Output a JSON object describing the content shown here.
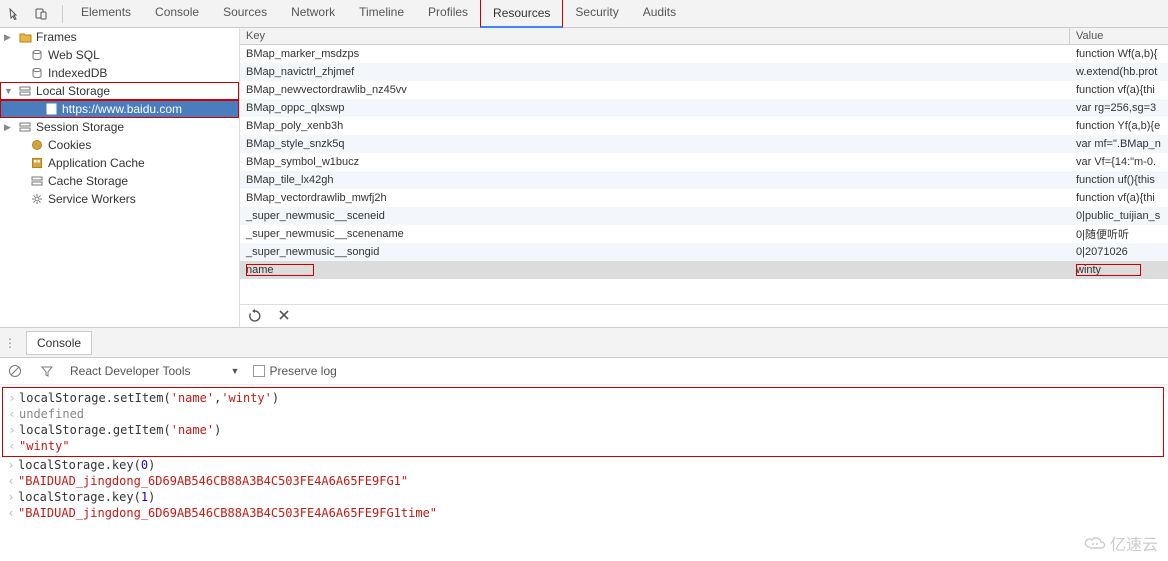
{
  "tabs": {
    "items": [
      "Elements",
      "Console",
      "Sources",
      "Network",
      "Timeline",
      "Profiles",
      "Resources",
      "Security",
      "Audits"
    ],
    "active_index": 6
  },
  "sidebar": {
    "items": [
      {
        "label": "Frames",
        "icon": "folder",
        "expandable": true,
        "expanded": false,
        "indent": 0
      },
      {
        "label": "Web SQL",
        "icon": "db",
        "expandable": false,
        "indent": 1
      },
      {
        "label": "IndexedDB",
        "icon": "db",
        "expandable": false,
        "indent": 1
      },
      {
        "label": "Local Storage",
        "icon": "storage",
        "expandable": true,
        "expanded": true,
        "indent": 0,
        "highlight": true
      },
      {
        "label": "https://www.baidu.com",
        "icon": "page",
        "expandable": false,
        "indent": 2,
        "selected": true,
        "highlight": true
      },
      {
        "label": "Session Storage",
        "icon": "storage",
        "expandable": true,
        "expanded": false,
        "indent": 0
      },
      {
        "label": "Cookies",
        "icon": "cookie",
        "expandable": false,
        "indent": 1
      },
      {
        "label": "Application Cache",
        "icon": "appcache",
        "expandable": false,
        "indent": 1
      },
      {
        "label": "Cache Storage",
        "icon": "cache",
        "expandable": false,
        "indent": 1
      },
      {
        "label": "Service Workers",
        "icon": "gear",
        "expandable": false,
        "indent": 1
      }
    ]
  },
  "table": {
    "headers": {
      "key": "Key",
      "value": "Value"
    },
    "rows": [
      {
        "key": "BMap_marker_msdzps",
        "value": "function Wf(a,b){"
      },
      {
        "key": "BMap_navictrl_zhjmef",
        "value": "w.extend(hb.prot"
      },
      {
        "key": "BMap_newvectordrawlib_nz45vv",
        "value": "function vf(a){thi"
      },
      {
        "key": "BMap_oppc_qlxswp",
        "value": "var rg=256,sg=3"
      },
      {
        "key": "BMap_poly_xenb3h",
        "value": "function Yf(a,b){e"
      },
      {
        "key": "BMap_style_snzk5q",
        "value": "var mf=\".BMap_n"
      },
      {
        "key": "BMap_symbol_w1bucz",
        "value": "var Vf={14:\"m-0."
      },
      {
        "key": "BMap_tile_lx42gh",
        "value": "function uf(){this"
      },
      {
        "key": "BMap_vectordrawlib_mwfj2h",
        "value": "function vf(a){thi"
      },
      {
        "key": "_super_newmusic__sceneid",
        "value": "0|public_tuijian_s"
      },
      {
        "key": "_super_newmusic__scenename",
        "value": "0|随便听听"
      },
      {
        "key": "_super_newmusic__songid",
        "value": "0|2071026"
      },
      {
        "key": "name",
        "value": "winty",
        "selected": true,
        "key_hl": true,
        "val_hl": true
      }
    ]
  },
  "toolbar": {
    "refresh": "↻",
    "delete": "✕"
  },
  "drawer": {
    "tab_label": "Console",
    "tools_label": "React Developer Tools",
    "preserve_label": "Preserve log"
  },
  "console": {
    "lines": [
      {
        "type": "in",
        "text": "localStorage.setItem('name','winty')",
        "hl": true,
        "parts": [
          [
            "plain",
            "localStorage.setItem("
          ],
          [
            "str",
            "'name'"
          ],
          [
            "plain",
            ","
          ],
          [
            "str",
            "'winty'"
          ],
          [
            "plain",
            ")"
          ]
        ]
      },
      {
        "type": "out",
        "text": "undefined",
        "hl": true,
        "cls": "code-undef"
      },
      {
        "type": "in",
        "text": "localStorage.getItem('name')",
        "hl": true,
        "parts": [
          [
            "plain",
            "localStorage.getItem("
          ],
          [
            "str",
            "'name'"
          ],
          [
            "plain",
            ")"
          ]
        ]
      },
      {
        "type": "out",
        "text": "\"winty\"",
        "hl": true,
        "cls": "code-str"
      },
      {
        "type": "in",
        "text": "localStorage.key(0)",
        "parts": [
          [
            "plain",
            "localStorage.key("
          ],
          [
            "num",
            "0"
          ],
          [
            "plain",
            ")"
          ]
        ]
      },
      {
        "type": "out",
        "text": "\"BAIDUAD_jingdong_6D69AB546CB88A3B4C503FE4A6A65FE9FG1\"",
        "cls": "code-str"
      },
      {
        "type": "in",
        "text": "localStorage.key(1)",
        "parts": [
          [
            "plain",
            "localStorage.key("
          ],
          [
            "num",
            "1"
          ],
          [
            "plain",
            ")"
          ]
        ]
      },
      {
        "type": "out",
        "text": "\"BAIDUAD_jingdong_6D69AB546CB88A3B4C503FE4A6A65FE9FG1time\"",
        "cls": "code-str"
      }
    ]
  },
  "watermark": "亿速云"
}
